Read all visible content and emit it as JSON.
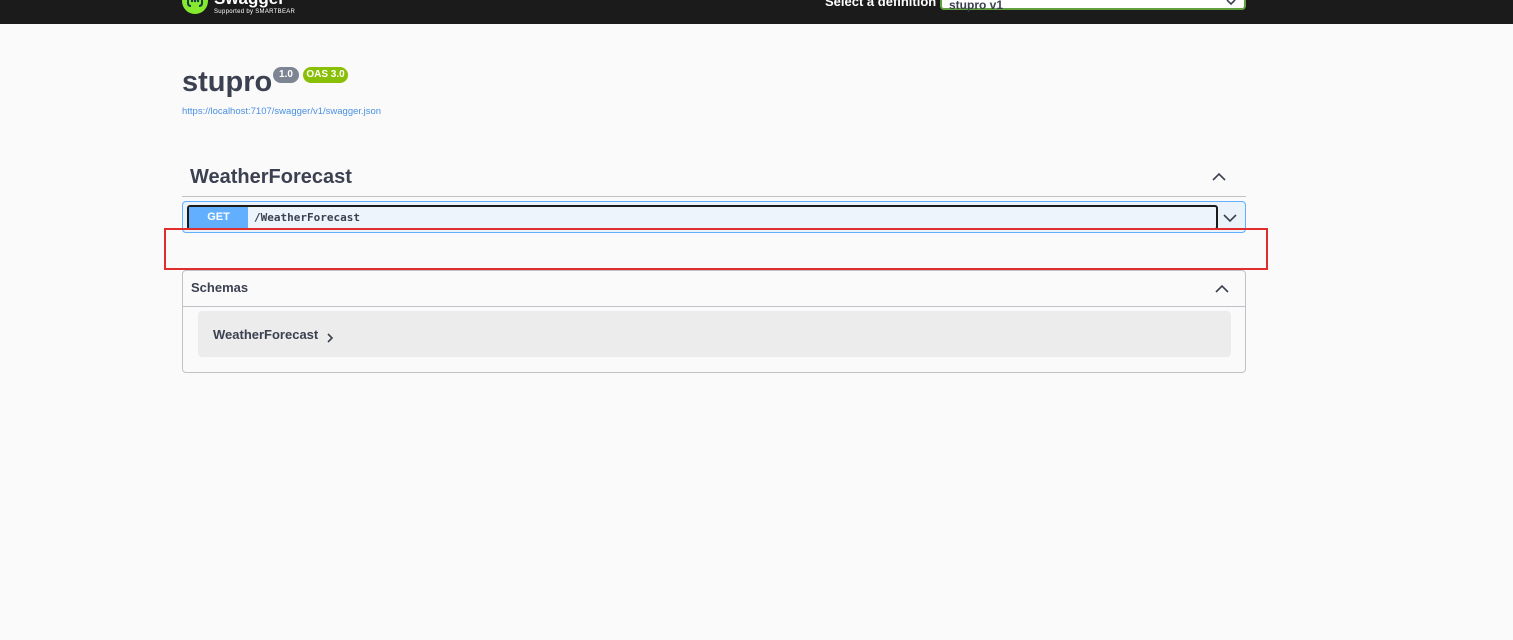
{
  "topbar": {
    "logo_name": "Swagger",
    "logo_sub": "Supported by SMARTBEAR",
    "definition_label": "Select a definition",
    "definition_value": "stupro v1"
  },
  "info": {
    "title": "stupro",
    "version_badge": "1.0",
    "oas_badge": "OAS 3.0",
    "spec_url": "https://localhost:7107/swagger/v1/swagger.json"
  },
  "tag": {
    "name": "WeatherForecast",
    "operations": [
      {
        "method": "GET",
        "path": "/WeatherForecast"
      }
    ]
  },
  "schemas": {
    "title": "Schemas",
    "items": [
      {
        "name": "WeatherForecast"
      }
    ]
  },
  "colors": {
    "topbar": "#1b1b1b",
    "get_method": "#61affe",
    "oas_badge": "#89bf04",
    "version_badge": "#7d8492",
    "highlight": "#e02d2d"
  }
}
